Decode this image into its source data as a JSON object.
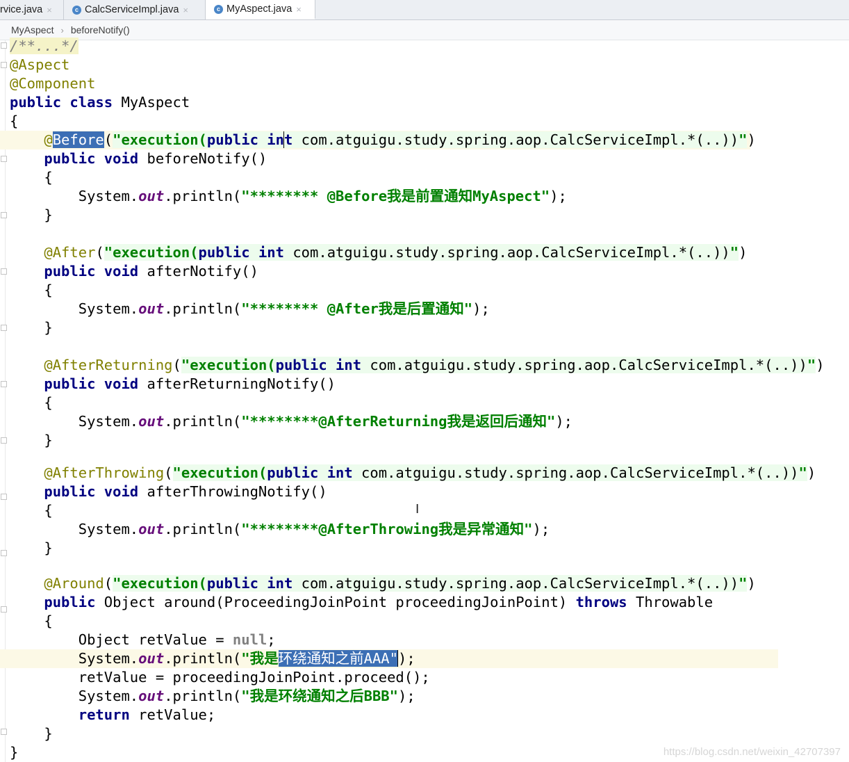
{
  "tabs": [
    {
      "label": "rvice.java",
      "icon": "class-icon"
    },
    {
      "label": "CalcServiceImpl.java",
      "icon": "class-icon"
    },
    {
      "label": "MyAspect.java",
      "icon": "class-icon",
      "active": true
    }
  ],
  "close_glyph": "×",
  "breadcrumb": {
    "items": [
      "MyAspect",
      "beforeNotify()"
    ],
    "separator": "›"
  },
  "code": {
    "comment_fold": "/**...*/",
    "ann_aspect": "@Aspect",
    "ann_component": "@Component",
    "class_kw": "public class",
    "class_name": " MyAspect",
    "brace_open": "{",
    "brace_close": "}",
    "at": "@",
    "before": "Before",
    "after": "@After",
    "after_returning": "@AfterReturning",
    "after_throwing": "@AfterThrowing",
    "around": "@Around",
    "paren_open": "(",
    "paren_close": ")",
    "quote": "\"",
    "exec_kw": "execution(",
    "exec_public": "public",
    "exec_int": "int",
    "in": "in",
    "t": "t",
    "exec_tail": " com.atguigu.study.spring.aop.CalcServiceImpl.*(..))",
    "public_void": "public void",
    "public_kw": "public",
    "m_before": " beforeNotify()",
    "m_after": " afterNotify()",
    "m_returning": " afterReturningNotify()",
    "m_throwing": " afterThrowingNotify()",
    "m_around": " Object around(ProceedingJoinPoint proceedingJoinPoint) ",
    "throws_kw": "throws",
    "throwable": " Throwable",
    "system": "System.",
    "out": "out",
    "println": ".println(",
    "end_stmt": ");",
    "s_before": "\"******** @Before我是前置通知MyAspect\"",
    "s_after": "\"******** @After我是后置通知\"",
    "s_returning": "\"********@AfterReturning我是返回后通知\"",
    "s_throwing": "\"********@AfterThrowing我是异常通知\"",
    "obj_decl": "Object retValue = ",
    "null_kw": "null",
    "semi": ";",
    "s_around1a": "\"我是",
    "s_around1b": "环绕通知之前AAA\"",
    "proceed": "retValue = proceedingJoinPoint.proceed();",
    "s_around2": "\"我是环绕通知之后BBB\"",
    "return_kw": "return",
    "ret_val": " retValue;"
  },
  "watermark": "https://blog.csdn.net/weixin_42707397",
  "colors": {
    "keyword": "#000080",
    "annotation": "#808000",
    "string": "#008000",
    "field": "#660e7a",
    "selection": "#3c6fb5"
  }
}
